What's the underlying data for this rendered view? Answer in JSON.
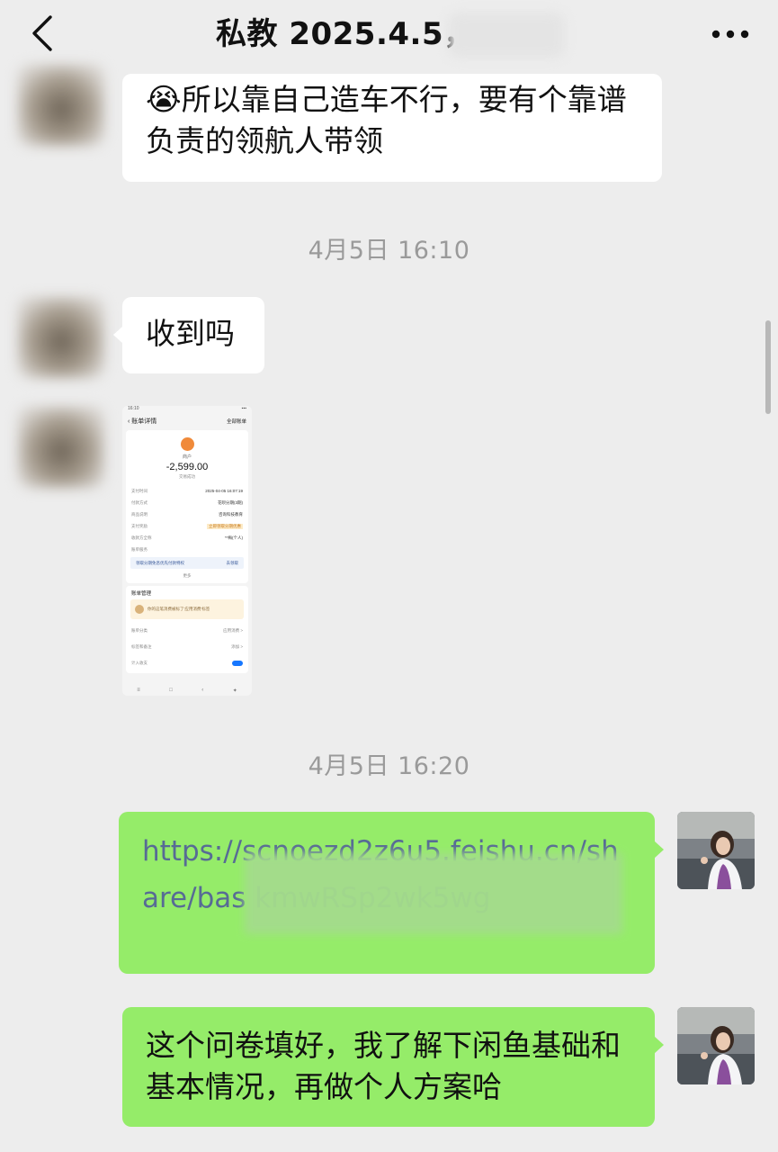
{
  "header": {
    "title": "私教 2025.4.5，",
    "back_icon": "chevron-left-icon",
    "more_icon": "more-dots-icon"
  },
  "messages": {
    "m1": {
      "text": "所以靠自己造车不行，要有个靠谱负责的领航人带领",
      "emoji": "😭"
    },
    "ts1": "4月5日 16:10",
    "m2": {
      "text": "收到吗"
    },
    "ts2": "4月5日 16:20",
    "m3": {
      "link_text": "https://scnoezd2z6u5.feishu.cn/share/bas                         kmwRSp2wk5wg"
    },
    "m4": {
      "text": "这个问卷填好，我了解下闲鱼基础和基本情况，再做个人方案哈"
    }
  },
  "screenshot": {
    "status_time": "16:10",
    "nav_title": "账单详情",
    "nav_right": "全部账单",
    "merchant": "商户",
    "amount": "-2,599.00",
    "status": "交易成功",
    "rows": [
      {
        "label": "支付时间",
        "value": "2025-04-05 16:07:19"
      },
      {
        "label": "付款方式",
        "value": "花呗分期(3期)"
      },
      {
        "label": "商品说明",
        "value": "咨询科技教育"
      },
      {
        "label": "支付奖励",
        "value": "立即领取分期优惠"
      },
      {
        "label": "收款方全称",
        "value": "**梅(个人)"
      },
      {
        "label": "账单服务",
        "value": ""
      }
    ],
    "promo": "领取分期免息优先付款特权",
    "promo_action": "去领取",
    "more": "更多",
    "section": "账单管理",
    "tip": "你的这笔消费被标了'应用消费'标签",
    "manage_rows": [
      {
        "label": "账单分类",
        "value": "应用消费 >"
      },
      {
        "label": "标签和备注",
        "value": "添加 >"
      },
      {
        "label": "计入收支",
        "value": ""
      }
    ]
  },
  "colors": {
    "background": "#ededed",
    "bubble_in": "#ffffff",
    "bubble_out": "#95ec69",
    "link": "#576b95",
    "timestamp": "#9a9a9a",
    "amount_badge": "#f08a3a"
  }
}
